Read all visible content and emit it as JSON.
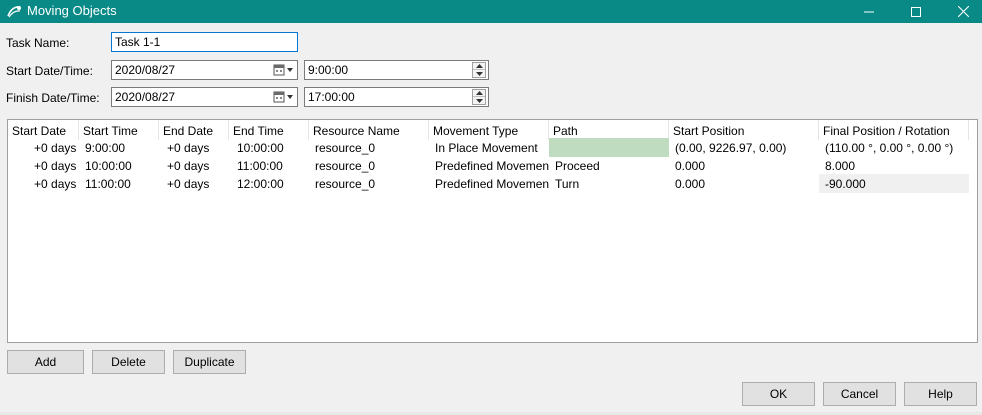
{
  "window": {
    "title": "Moving Objects"
  },
  "form": {
    "task_name_label": "Task Name:",
    "task_name_value": "Task 1-1",
    "start_label": "Start Date/Time:",
    "start_date": "2020/08/27",
    "start_time": "9:00:00",
    "finish_label": "Finish Date/Time:",
    "finish_date": "2020/08/27",
    "finish_time": "17:00:00"
  },
  "table": {
    "columns": [
      "Start Date",
      "Start Time",
      "End Date",
      "End Time",
      "Resource Name",
      "Movement Type",
      "Path",
      "Start Position",
      "Final Position / Rotation"
    ],
    "rows": [
      {
        "start_date": "+0 days",
        "start_time": "9:00:00",
        "end_date": "+0 days",
        "end_time": "10:00:00",
        "resource": "resource_0",
        "movement": "In Place Movement",
        "path": "",
        "start_pos": "(0.00, 9226.97, 0.00)",
        "final_pos": "(110.00 °, 0.00 °, 0.00 °)"
      },
      {
        "start_date": "+0 days",
        "start_time": "10:00:00",
        "end_date": "+0 days",
        "end_time": "11:00:00",
        "resource": "resource_0",
        "movement": "Predefined Movement",
        "path": "Proceed",
        "start_pos": "0.000",
        "final_pos": "8.000"
      },
      {
        "start_date": "+0 days",
        "start_time": "11:00:00",
        "end_date": "+0 days",
        "end_time": "12:00:00",
        "resource": "resource_0",
        "movement": "Predefined Movement",
        "path": "Turn",
        "start_pos": "0.000",
        "final_pos": "-90.000"
      }
    ]
  },
  "buttons": {
    "add": "Add",
    "delete": "Delete",
    "duplicate": "Duplicate",
    "ok": "OK",
    "cancel": "Cancel",
    "help": "Help"
  },
  "colors": {
    "titlebar": "#098a87",
    "empty_path_cell": "#c0dcc0",
    "focus_border": "#0078d7"
  },
  "icons": {
    "app": "moving-objects-app-icon",
    "calendar": "calendar-dropdown-icon",
    "spinner": "spin-arrows-icon"
  }
}
